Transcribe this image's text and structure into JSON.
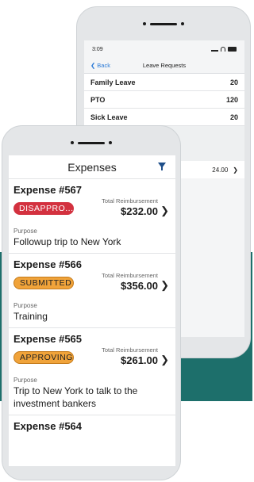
{
  "back_phone": {
    "status_time": "3:09",
    "nav": {
      "back_label": "Back",
      "title": "Leave Requests"
    },
    "leave_rows": [
      {
        "label": "Family Leave",
        "value": "20"
      },
      {
        "label": "PTO",
        "value": "120"
      },
      {
        "label": "Sick Leave",
        "value": "20"
      }
    ],
    "partial_amount": "24.00"
  },
  "front_phone": {
    "title": "Expenses",
    "reimbursement_label": "Total Reimbursement",
    "purpose_label": "Purpose",
    "expenses": [
      {
        "title": "Expense #567",
        "status": "DISAPPRO...",
        "amount": "$232.00",
        "purpose": "Followup trip to New York"
      },
      {
        "title": "Expense #566",
        "status": "SUBMITTED",
        "amount": "$356.00",
        "purpose": "Training"
      },
      {
        "title": "Expense #565",
        "status": "APPROVING",
        "amount": "$261.00",
        "purpose": "Trip to New York to talk to the investment bankers"
      },
      {
        "title": "Expense #564"
      }
    ]
  },
  "colors": {
    "teal_band": "#1d6f6b",
    "status_disapproved": "#d3313f",
    "status_pending": "#f0a33a",
    "link_blue": "#2a7ad6",
    "filter_icon": "#1f4f8a"
  }
}
